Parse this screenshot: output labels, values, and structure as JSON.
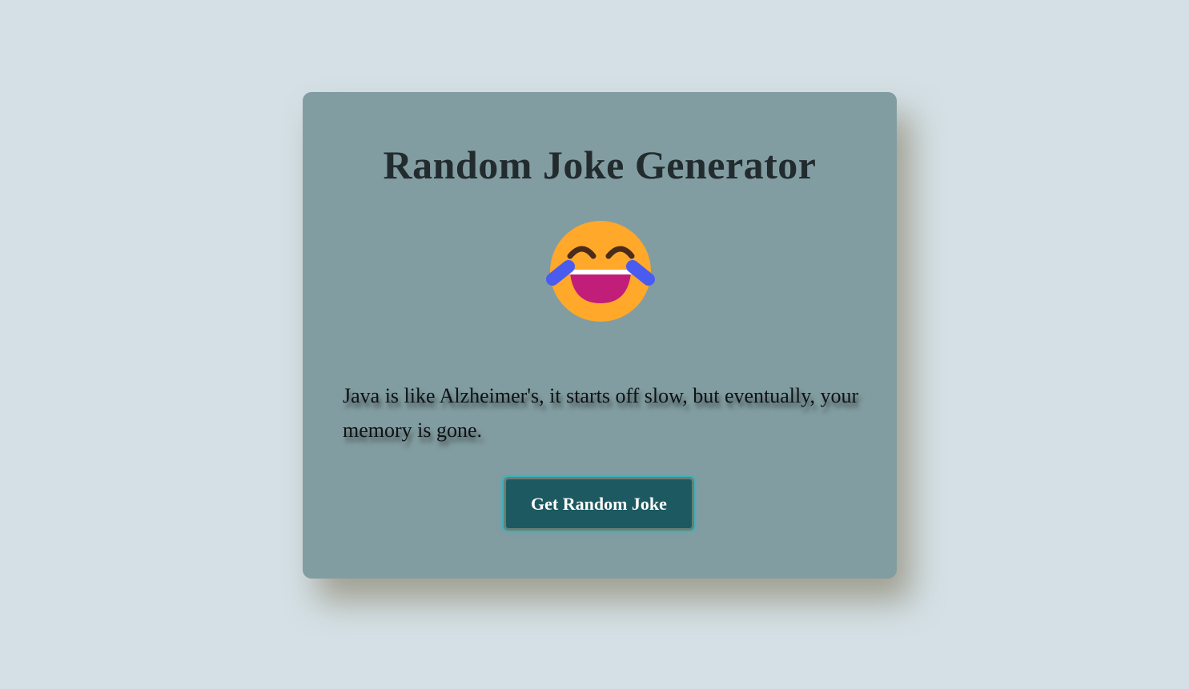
{
  "app": {
    "title": "Random Joke Generator"
  },
  "emoji": {
    "icon": "laughing-tears-emoji-icon",
    "colors": {
      "face": "#ffa82a",
      "mouth": "#c01e78",
      "teeth": "#ffffff",
      "eyes": "#4a2b1c",
      "tears": "#4a5cf0"
    }
  },
  "joke": {
    "text": "Java is like Alzheimer's, it starts off slow, but eventually, your memory is gone."
  },
  "controls": {
    "get_joke_label": "Get Random Joke"
  },
  "theme": {
    "page_background": "#d4e0e5",
    "card_background": "#829da1",
    "button_background": "#1c5960",
    "button_text": "#ffffff"
  }
}
